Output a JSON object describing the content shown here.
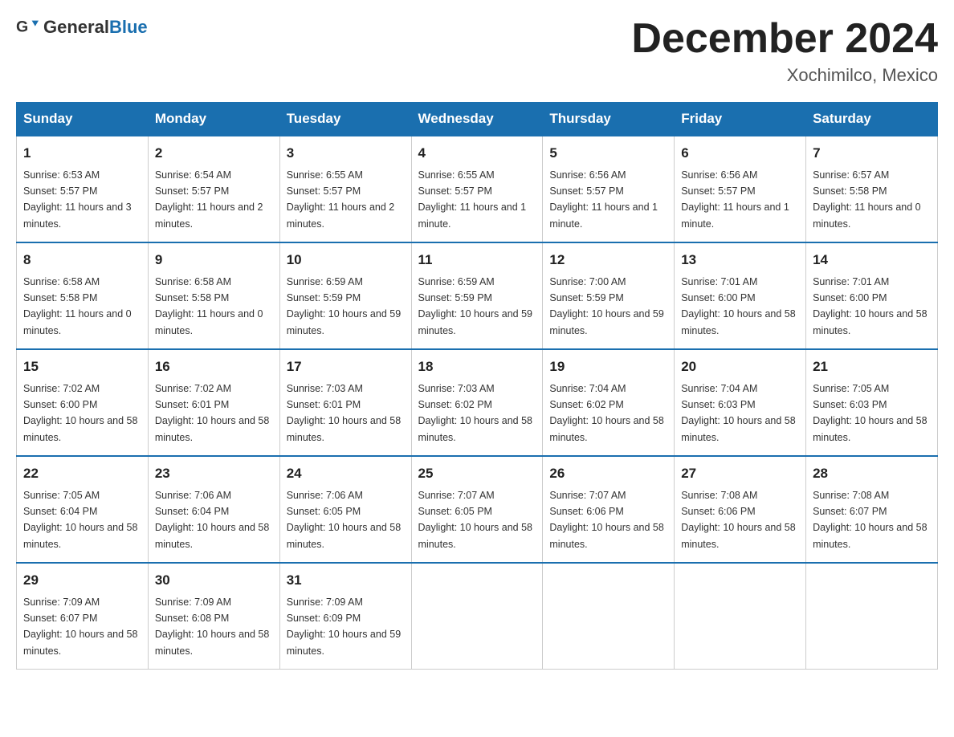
{
  "header": {
    "logo_general": "General",
    "logo_blue": "Blue",
    "month_title": "December 2024",
    "location": "Xochimilco, Mexico"
  },
  "days_of_week": [
    "Sunday",
    "Monday",
    "Tuesday",
    "Wednesday",
    "Thursday",
    "Friday",
    "Saturday"
  ],
  "weeks": [
    [
      {
        "day": "1",
        "sunrise": "6:53 AM",
        "sunset": "5:57 PM",
        "daylight": "11 hours and 3 minutes."
      },
      {
        "day": "2",
        "sunrise": "6:54 AM",
        "sunset": "5:57 PM",
        "daylight": "11 hours and 2 minutes."
      },
      {
        "day": "3",
        "sunrise": "6:55 AM",
        "sunset": "5:57 PM",
        "daylight": "11 hours and 2 minutes."
      },
      {
        "day": "4",
        "sunrise": "6:55 AM",
        "sunset": "5:57 PM",
        "daylight": "11 hours and 1 minute."
      },
      {
        "day": "5",
        "sunrise": "6:56 AM",
        "sunset": "5:57 PM",
        "daylight": "11 hours and 1 minute."
      },
      {
        "day": "6",
        "sunrise": "6:56 AM",
        "sunset": "5:57 PM",
        "daylight": "11 hours and 1 minute."
      },
      {
        "day": "7",
        "sunrise": "6:57 AM",
        "sunset": "5:58 PM",
        "daylight": "11 hours and 0 minutes."
      }
    ],
    [
      {
        "day": "8",
        "sunrise": "6:58 AM",
        "sunset": "5:58 PM",
        "daylight": "11 hours and 0 minutes."
      },
      {
        "day": "9",
        "sunrise": "6:58 AM",
        "sunset": "5:58 PM",
        "daylight": "11 hours and 0 minutes."
      },
      {
        "day": "10",
        "sunrise": "6:59 AM",
        "sunset": "5:59 PM",
        "daylight": "10 hours and 59 minutes."
      },
      {
        "day": "11",
        "sunrise": "6:59 AM",
        "sunset": "5:59 PM",
        "daylight": "10 hours and 59 minutes."
      },
      {
        "day": "12",
        "sunrise": "7:00 AM",
        "sunset": "5:59 PM",
        "daylight": "10 hours and 59 minutes."
      },
      {
        "day": "13",
        "sunrise": "7:01 AM",
        "sunset": "6:00 PM",
        "daylight": "10 hours and 58 minutes."
      },
      {
        "day": "14",
        "sunrise": "7:01 AM",
        "sunset": "6:00 PM",
        "daylight": "10 hours and 58 minutes."
      }
    ],
    [
      {
        "day": "15",
        "sunrise": "7:02 AM",
        "sunset": "6:00 PM",
        "daylight": "10 hours and 58 minutes."
      },
      {
        "day": "16",
        "sunrise": "7:02 AM",
        "sunset": "6:01 PM",
        "daylight": "10 hours and 58 minutes."
      },
      {
        "day": "17",
        "sunrise": "7:03 AM",
        "sunset": "6:01 PM",
        "daylight": "10 hours and 58 minutes."
      },
      {
        "day": "18",
        "sunrise": "7:03 AM",
        "sunset": "6:02 PM",
        "daylight": "10 hours and 58 minutes."
      },
      {
        "day": "19",
        "sunrise": "7:04 AM",
        "sunset": "6:02 PM",
        "daylight": "10 hours and 58 minutes."
      },
      {
        "day": "20",
        "sunrise": "7:04 AM",
        "sunset": "6:03 PM",
        "daylight": "10 hours and 58 minutes."
      },
      {
        "day": "21",
        "sunrise": "7:05 AM",
        "sunset": "6:03 PM",
        "daylight": "10 hours and 58 minutes."
      }
    ],
    [
      {
        "day": "22",
        "sunrise": "7:05 AM",
        "sunset": "6:04 PM",
        "daylight": "10 hours and 58 minutes."
      },
      {
        "day": "23",
        "sunrise": "7:06 AM",
        "sunset": "6:04 PM",
        "daylight": "10 hours and 58 minutes."
      },
      {
        "day": "24",
        "sunrise": "7:06 AM",
        "sunset": "6:05 PM",
        "daylight": "10 hours and 58 minutes."
      },
      {
        "day": "25",
        "sunrise": "7:07 AM",
        "sunset": "6:05 PM",
        "daylight": "10 hours and 58 minutes."
      },
      {
        "day": "26",
        "sunrise": "7:07 AM",
        "sunset": "6:06 PM",
        "daylight": "10 hours and 58 minutes."
      },
      {
        "day": "27",
        "sunrise": "7:08 AM",
        "sunset": "6:06 PM",
        "daylight": "10 hours and 58 minutes."
      },
      {
        "day": "28",
        "sunrise": "7:08 AM",
        "sunset": "6:07 PM",
        "daylight": "10 hours and 58 minutes."
      }
    ],
    [
      {
        "day": "29",
        "sunrise": "7:09 AM",
        "sunset": "6:07 PM",
        "daylight": "10 hours and 58 minutes."
      },
      {
        "day": "30",
        "sunrise": "7:09 AM",
        "sunset": "6:08 PM",
        "daylight": "10 hours and 58 minutes."
      },
      {
        "day": "31",
        "sunrise": "7:09 AM",
        "sunset": "6:09 PM",
        "daylight": "10 hours and 59 minutes."
      },
      null,
      null,
      null,
      null
    ]
  ]
}
